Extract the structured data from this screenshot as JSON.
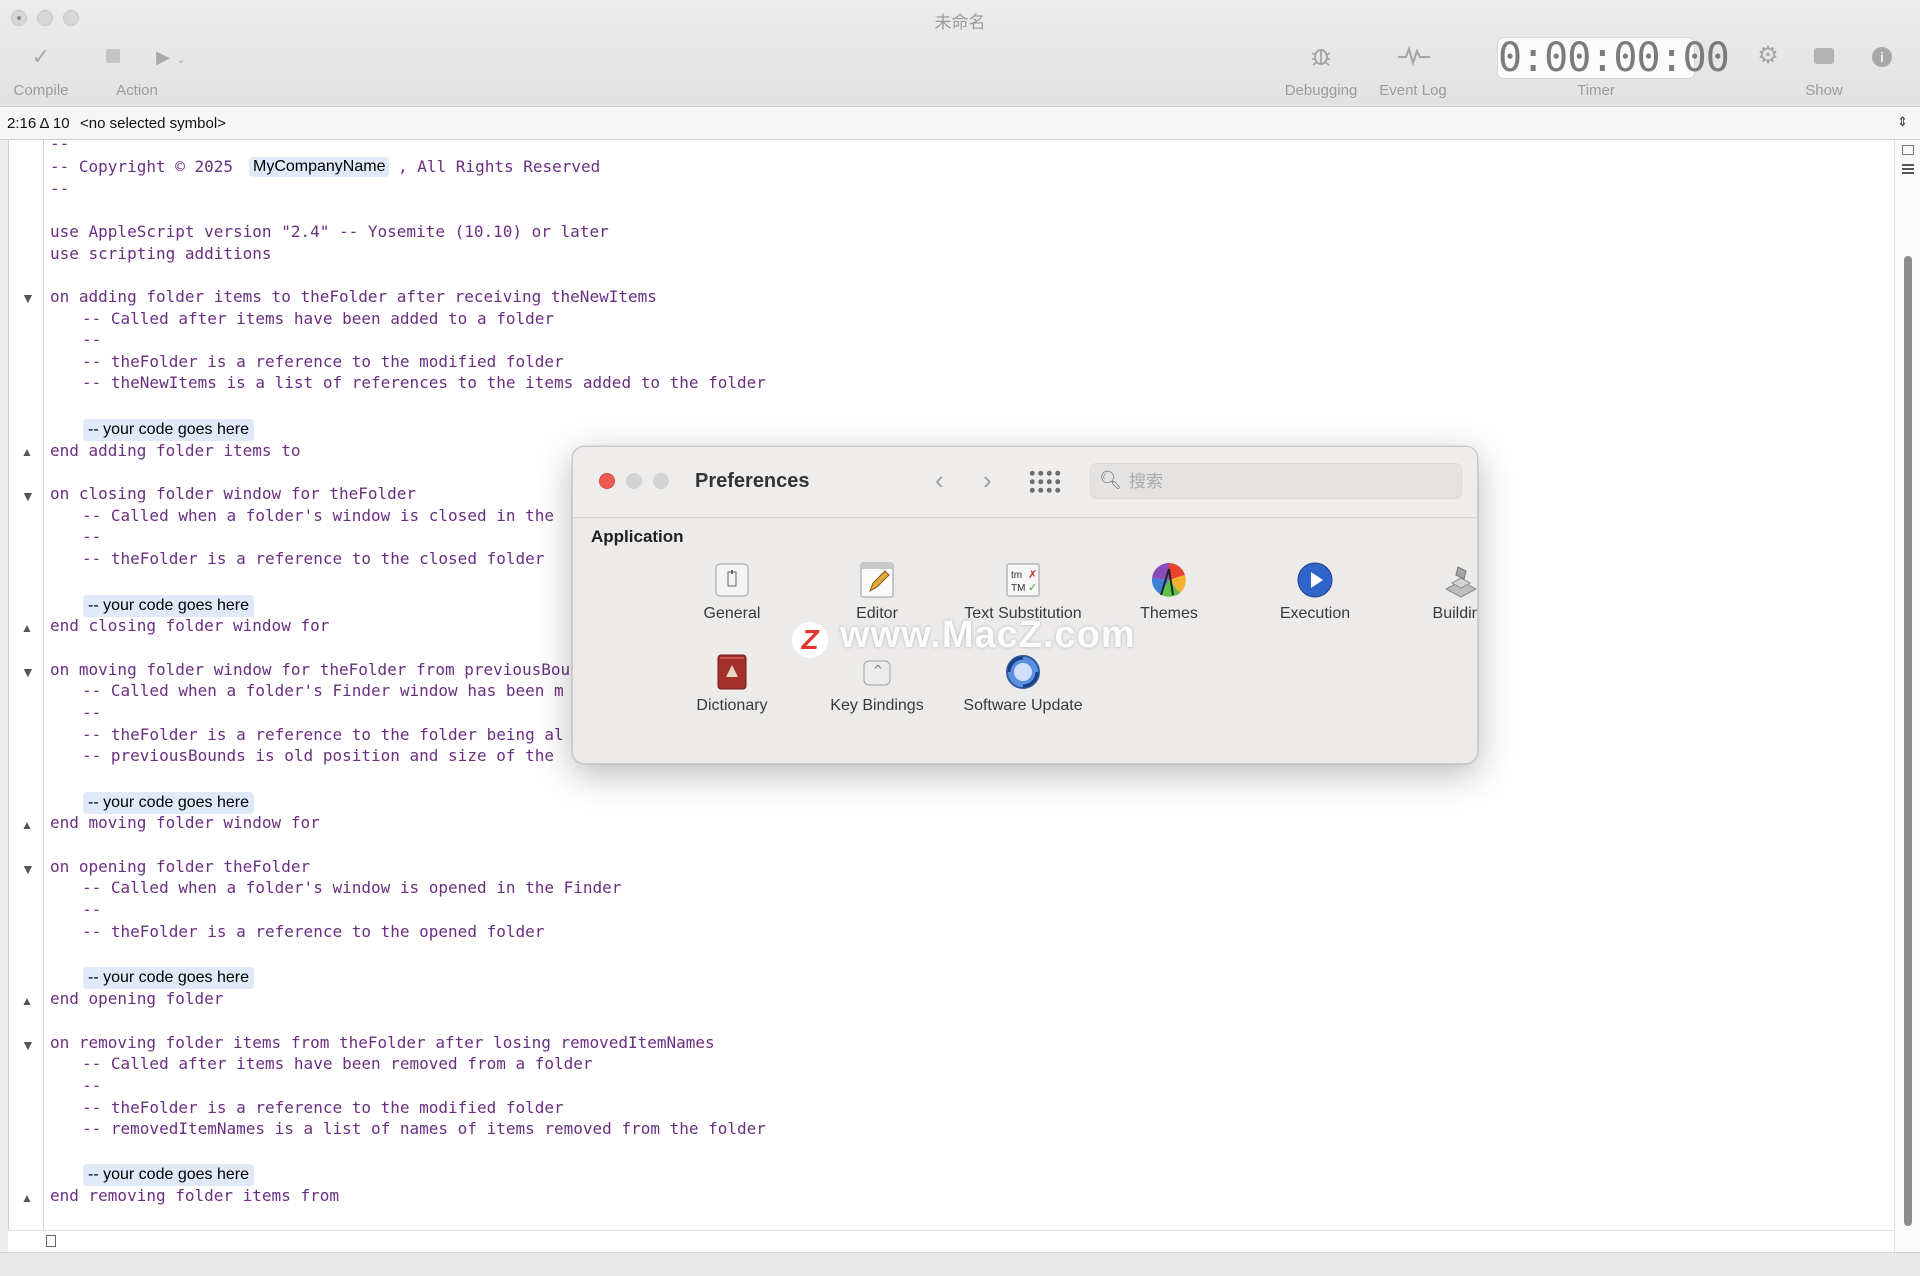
{
  "window": {
    "title": "未命名"
  },
  "toolbar": {
    "compile": "Compile",
    "action": "Action",
    "debugging": "Debugging",
    "event_log": "Event Log",
    "timer_label": "Timer",
    "timer_value": "0:00:00:00",
    "show": "Show"
  },
  "symbol_bar": {
    "position": "2:16 Δ 10",
    "symbol": "<no selected symbol>"
  },
  "code": {
    "lines": [
      "--",
      "-- Copyright © 2025 ",
      "MyCompanyName",
      ", All Rights Reserved",
      "--",
      "use AppleScript version \"2.4\" -- Yosemite (10.10) or later",
      "use scripting additions",
      "on adding folder items to theFolder after receiving theNewItems",
      "-- Called after items have been added to a folder",
      "--",
      "-- theFolder is a reference to the modified folder",
      "-- theNewItems is a list of references to the items added to the folder",
      "end adding folder items to",
      "on closing folder window for theFolder",
      "-- Called when a folder's window is closed in the",
      "--",
      "-- theFolder is a reference to the closed folder",
      "end closing folder window for",
      "on moving folder window for theFolder from previousBou",
      "-- Called when a folder's Finder window has been m",
      "--",
      "-- theFolder is a reference to the folder being al",
      "-- previousBounds is old position and size of the",
      "end moving folder window for",
      "on opening folder theFolder",
      "-- Called when a folder's window is opened in the Finder",
      "--",
      "-- theFolder is a reference to the opened folder",
      "end opening folder",
      "on removing folder items from theFolder after losing removedItemNames",
      "-- Called after items have been removed from a folder",
      "--",
      "-- theFolder is a reference to the modified folder",
      "-- removedItemNames is a list of names of items removed from the folder",
      "end removing folder items from"
    ],
    "placeholder": "-- your code goes here"
  },
  "preferences": {
    "title": "Preferences",
    "search_placeholder": "搜索",
    "section": "Application",
    "items": [
      {
        "label": "General",
        "icon": "general-icon"
      },
      {
        "label": "Editor",
        "icon": "editor-icon"
      },
      {
        "label": "Text Substitution",
        "icon": "text-substitution-icon"
      },
      {
        "label": "Themes",
        "icon": "themes-icon"
      },
      {
        "label": "Execution",
        "icon": "execution-icon"
      },
      {
        "label": "Building",
        "icon": "building-icon"
      },
      {
        "label": "Dictionary",
        "icon": "dictionary-icon"
      },
      {
        "label": "Key Bindings",
        "icon": "key-bindings-icon"
      },
      {
        "label": "Software Update",
        "icon": "software-update-icon"
      }
    ]
  },
  "watermark": {
    "text": "www.MacZ.com",
    "logo_letter": "Z"
  },
  "colors": {
    "code_text": "#6a2f80",
    "placeholder_bg": "#dfe9f8",
    "close_red": "#ee5c53"
  }
}
